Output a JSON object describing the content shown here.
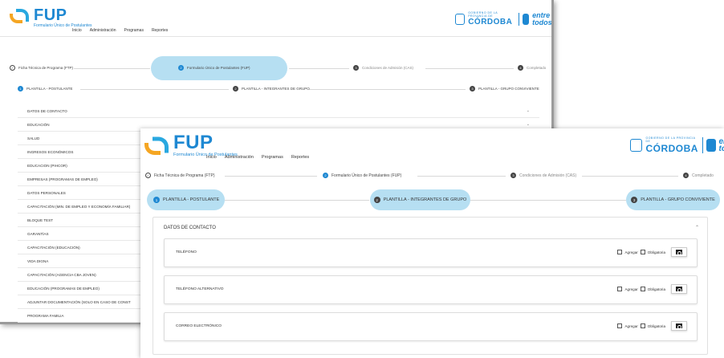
{
  "app": {
    "logo_text": "FUP",
    "logo_subtitle": "Formulario Único de Postulantes",
    "nav": [
      "Inicio",
      "Administración",
      "Programas",
      "Reportes"
    ],
    "brand_province": "CÓRDOBA",
    "brand_province_small": "GOBIERNO DE LA PROVINCIA DE",
    "brand_slogan_1": "entre",
    "brand_slogan_2": "todos"
  },
  "back": {
    "steps": [
      {
        "label": "Ficha Técnica de Programa (FTP)",
        "state": "done"
      },
      {
        "label": "Formulario Único de Postulantes (FUP)",
        "state": "active",
        "number": "2"
      },
      {
        "label": "Condiciones de Admisión (CAS)",
        "state": "pending",
        "number": "3"
      },
      {
        "label": "Completado",
        "state": "pending",
        "number": "4"
      }
    ],
    "substeps": [
      {
        "label": "PLANTILLA - POSTULANTE",
        "number": "1"
      },
      {
        "label": "PLANTILLA - INTEGRANTES DE GRUPO",
        "number": "2"
      },
      {
        "label": "PLANTILLA - GRUPO CONVIVIENTE",
        "number": "3"
      }
    ],
    "sections": [
      "DATOS DE CONTACTO",
      "EDUCACIÓN",
      "SALUD",
      "INGRESOS ECONÓMICOS",
      "EDUCACION (PIHCOR)",
      "EMPRESAS (PROGRAMAS DE EMPLEO)",
      "DATOS PERSONALES",
      "CAPACITACIÓN (MIN. DE EMPLEO Y ECONOMÍA FAMILIAR)",
      "BLOQUE TEST",
      "GARANTÍAS",
      "CAPACITACIÓN (EDUCACIÓN)",
      "VIDA DIGNA",
      "CAPACITACIÓN (AGENCIA CBA JOVEN)",
      "EDUCACIÓN (PROGRAMAS DE EMPLEO)",
      "ADJUNTAR DOCUMENTACIÓN (SOLO EN CASO DE CONST",
      "PROGRAMA FAMILIA"
    ]
  },
  "front": {
    "steps": [
      {
        "label": "Ficha Técnica de Programa (FTP)"
      },
      {
        "label": "Formulario Único de Postulantes (FUP)",
        "number": "2"
      },
      {
        "label": "Condiciones de Admisión (CAS)",
        "number": "3"
      },
      {
        "label": "Completado",
        "number": "4"
      }
    ],
    "substeps": [
      {
        "label": "PLANTILLA - POSTULANTE",
        "number": "1"
      },
      {
        "label": "PLANTILLA - INTEGRANTES DE GRUPO",
        "number": "2"
      },
      {
        "label": "PLANTILLA - GRUPO CONVIVIENTE",
        "number": "3"
      }
    ],
    "panel_title": "DATOS DE CONTACTO",
    "fields": [
      {
        "label": "TELÉFONO",
        "add": "Agregar",
        "required": "Obligatoria"
      },
      {
        "label": "TELÉFONO ALTERNATIVO",
        "add": "Agregar",
        "required": "Obligatoria"
      },
      {
        "label": "CORREO ELECTRÓNICO",
        "add": "Agregar",
        "required": "Obligatoria"
      }
    ]
  },
  "colors": {
    "accent": "#1e88d2",
    "pill": "#b6dff2",
    "logo_orange": "#f5a623"
  }
}
